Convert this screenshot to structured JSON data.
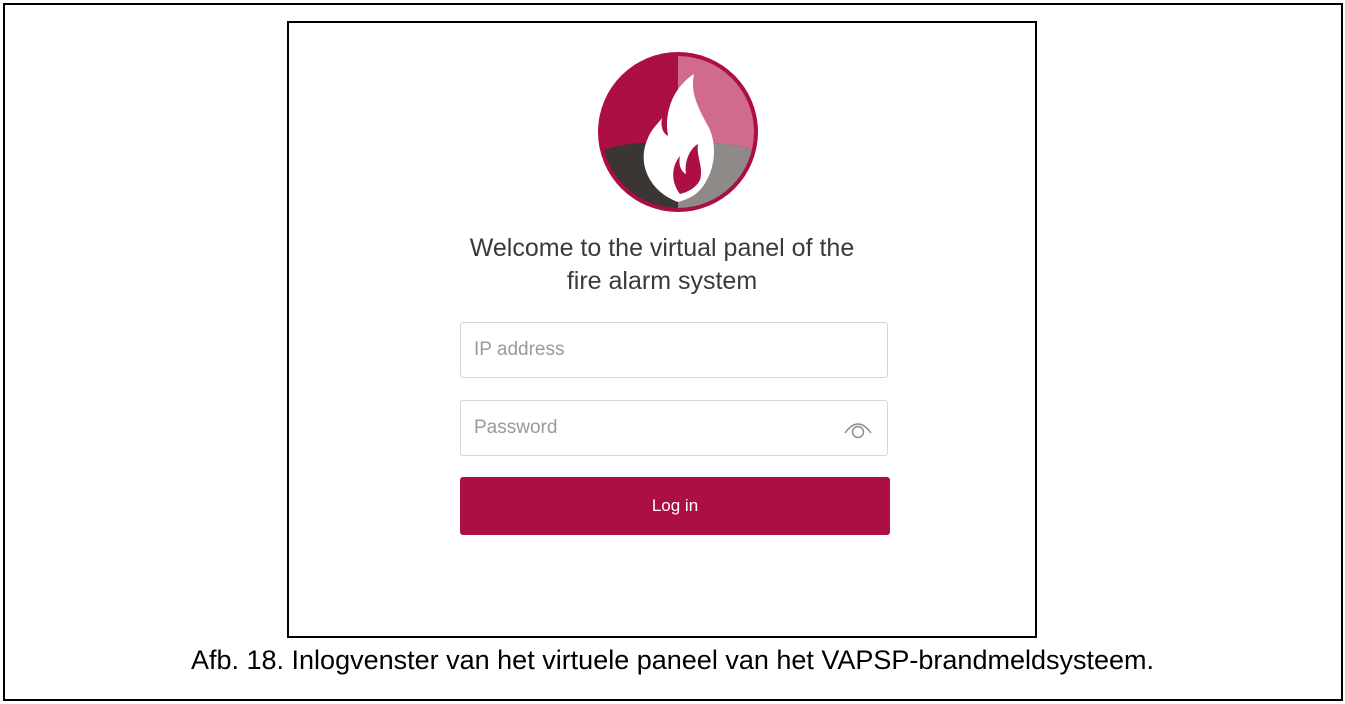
{
  "login": {
    "welcome_line1": "Welcome to the virtual panel of the",
    "welcome_line2": "fire alarm system",
    "ip_placeholder": "IP address",
    "ip_value": "",
    "password_placeholder": "Password",
    "password_value": "",
    "show_password_icon": "eye-icon",
    "login_button": "Log in"
  },
  "logo": {
    "icon": "flame-logo",
    "colors": {
      "crimson": "#ac0e46",
      "pink": "#d06a8e",
      "dark": "#3b3534",
      "gray": "#8e8a88"
    }
  },
  "caption": "Afb. 18. Inlogvenster van het virtuele paneel van het VAPSP-brandmeldsysteem.",
  "colors": {
    "accent": "#ac0e46",
    "border": "#d6d6d6",
    "placeholder": "#9a9a9a",
    "text": "#3a3a3a"
  }
}
